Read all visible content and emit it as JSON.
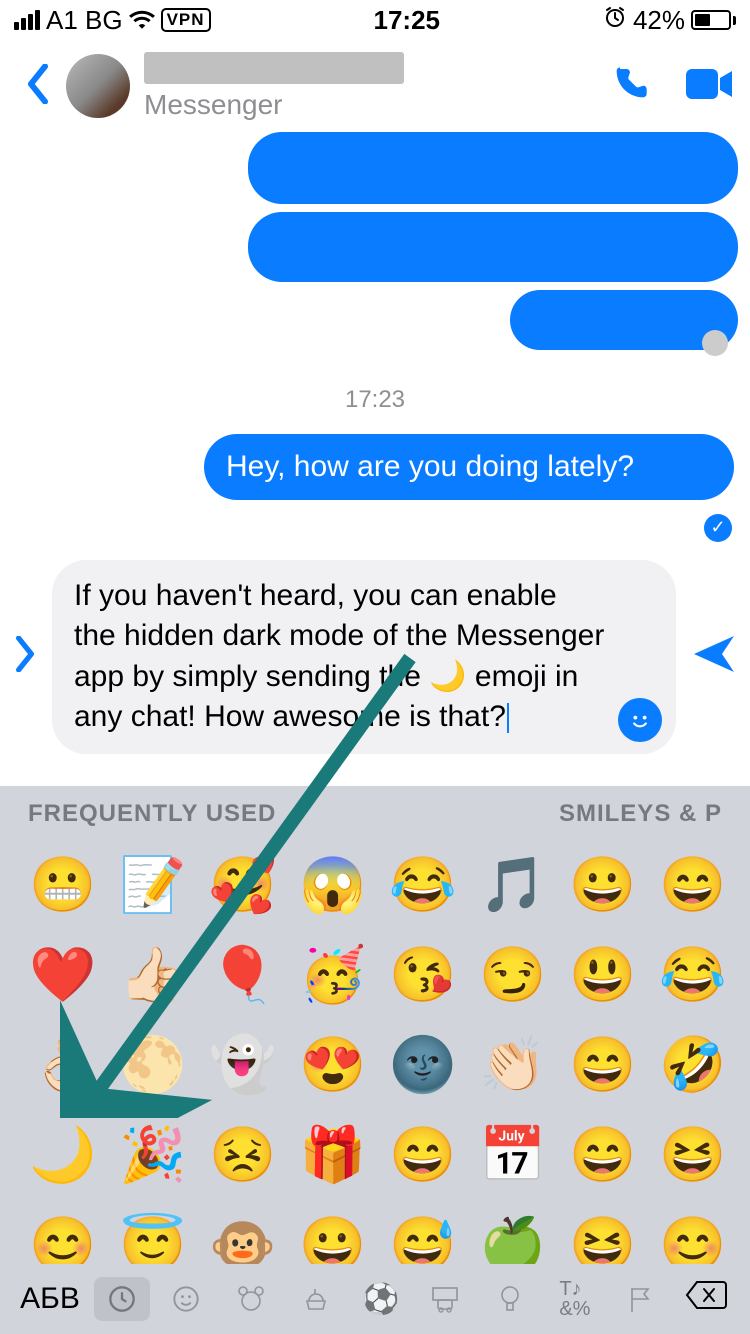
{
  "status": {
    "carrier": "A1 BG",
    "vpn": "VPN",
    "time": "17:25",
    "alarm_icon": "alarm",
    "battery_percent": "42%"
  },
  "header": {
    "contact_name": "",
    "subtitle": "Messenger"
  },
  "conversation": {
    "blurred_out_1": " ",
    "blurred_out_2": " ",
    "blurred_out_3": " ",
    "timestamp": "17:23",
    "out_message": "Hey, how are you doing lately?"
  },
  "composer": {
    "text_before_emoji": "If you haven't heard, you can enable the hidden dark mode of the Messenger app by simply sending the ",
    "text_after_emoji": " emoji in any chat! How awesome is that?"
  },
  "keyboard": {
    "header_left": "FREQUENTLY USED",
    "header_right": "SMILEYS & P",
    "emojis_freq": [
      [
        "😬",
        "📝",
        "🥰",
        "😱",
        "😂",
        "🎵",
        "😀",
        "😄"
      ],
      [
        "❤️",
        "👍🏻",
        "🎈",
        "🥳",
        "😘",
        "😏",
        "😃",
        "😂"
      ],
      [
        "👌🏻",
        "🌕",
        "👻",
        "😍",
        "🌚",
        "👏🏻",
        "😄",
        "🤣"
      ],
      [
        "🌙",
        "🎉",
        "😣",
        "🎁",
        "😄",
        "📅",
        "😄",
        "😆"
      ],
      [
        "😊",
        "😇",
        "🐵",
        "😀",
        "😅",
        "🍏",
        "😆",
        "😊"
      ]
    ],
    "abv_label": "АБВ",
    "categories": [
      "recent",
      "smileys",
      "animals",
      "food",
      "sports",
      "travel",
      "objects",
      "symbols",
      "flags"
    ]
  }
}
